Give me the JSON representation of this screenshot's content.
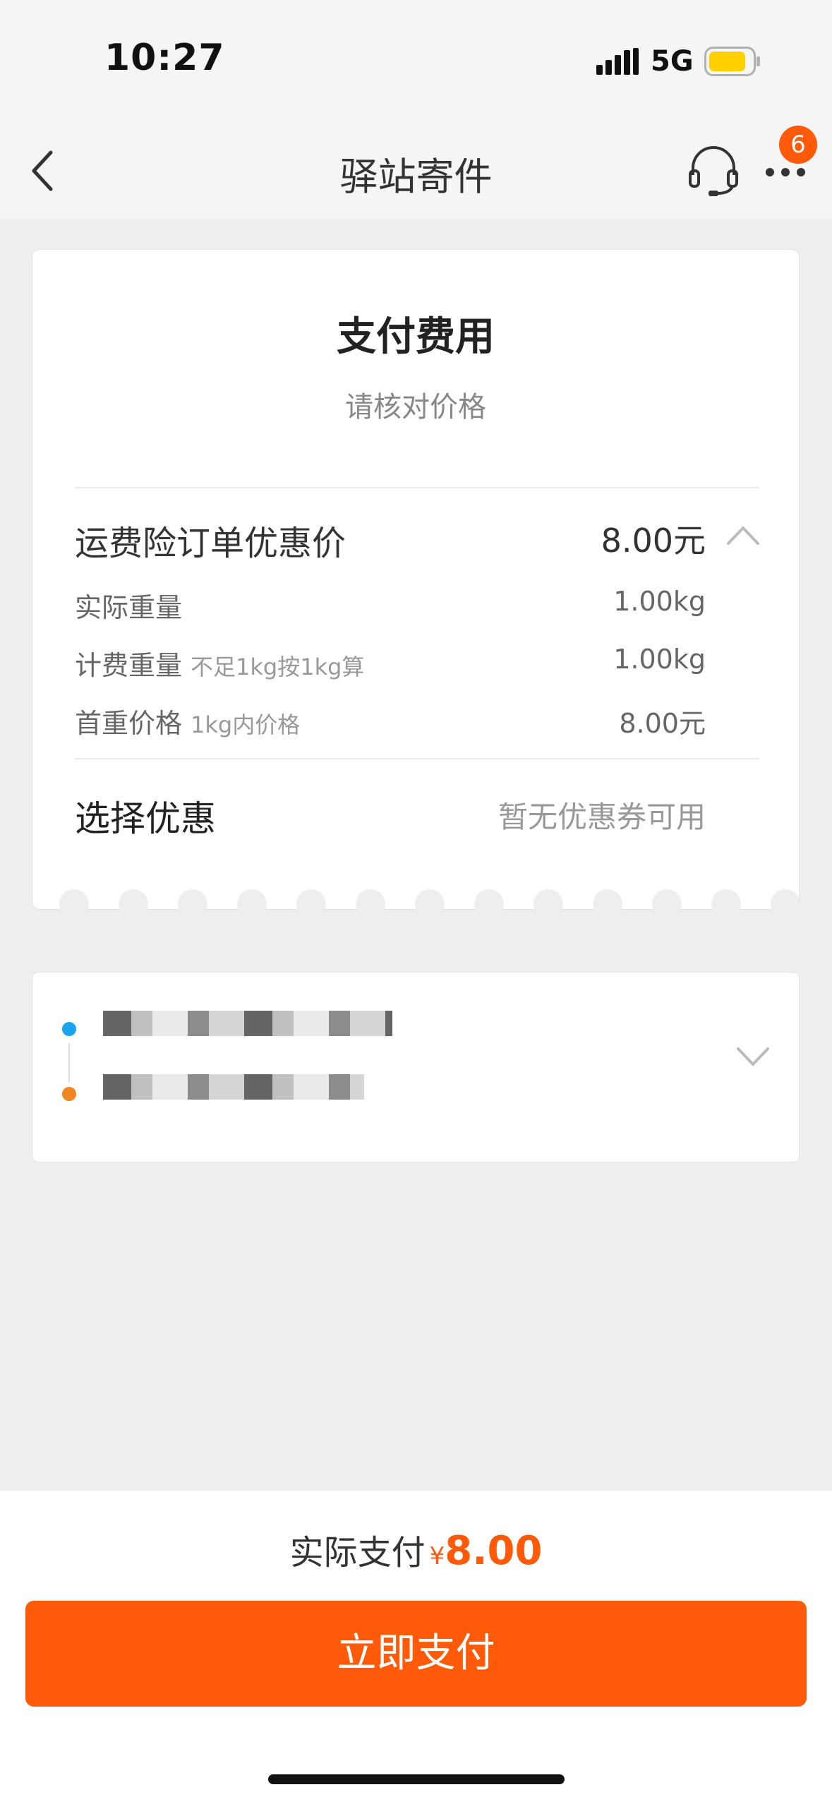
{
  "status_bar": {
    "time": "10:27",
    "network": "5G",
    "icons": [
      "signal-icon",
      "battery-icon"
    ]
  },
  "nav": {
    "title": "驿站寄件",
    "badge_count": "6",
    "icons": [
      "back-icon",
      "headset-icon",
      "more-icon"
    ]
  },
  "payment_card": {
    "title": "支付费用",
    "subtitle": "请核对价格",
    "price_row": {
      "label": "运费险订单优惠价",
      "value": "8.00元"
    },
    "details": [
      {
        "label": "实际重量",
        "note": "",
        "value": "1.00kg"
      },
      {
        "label": "计费重量",
        "note": "不足1kg按1kg算",
        "value": "1.00kg"
      },
      {
        "label": "首重价格",
        "note": "1kg内价格",
        "value": "8.00元"
      }
    ],
    "coupon": {
      "label": "选择优惠",
      "value": "暂无优惠券可用"
    }
  },
  "bottom": {
    "summary_label": "实际支付",
    "currency_symbol": "¥",
    "amount": "8.00",
    "pay_button": "立即支付"
  },
  "colors": {
    "accent": "#ff5a0a",
    "sender_dot": "#1aa3ee",
    "receiver_dot": "#f08524",
    "background": "#eeeeee"
  }
}
